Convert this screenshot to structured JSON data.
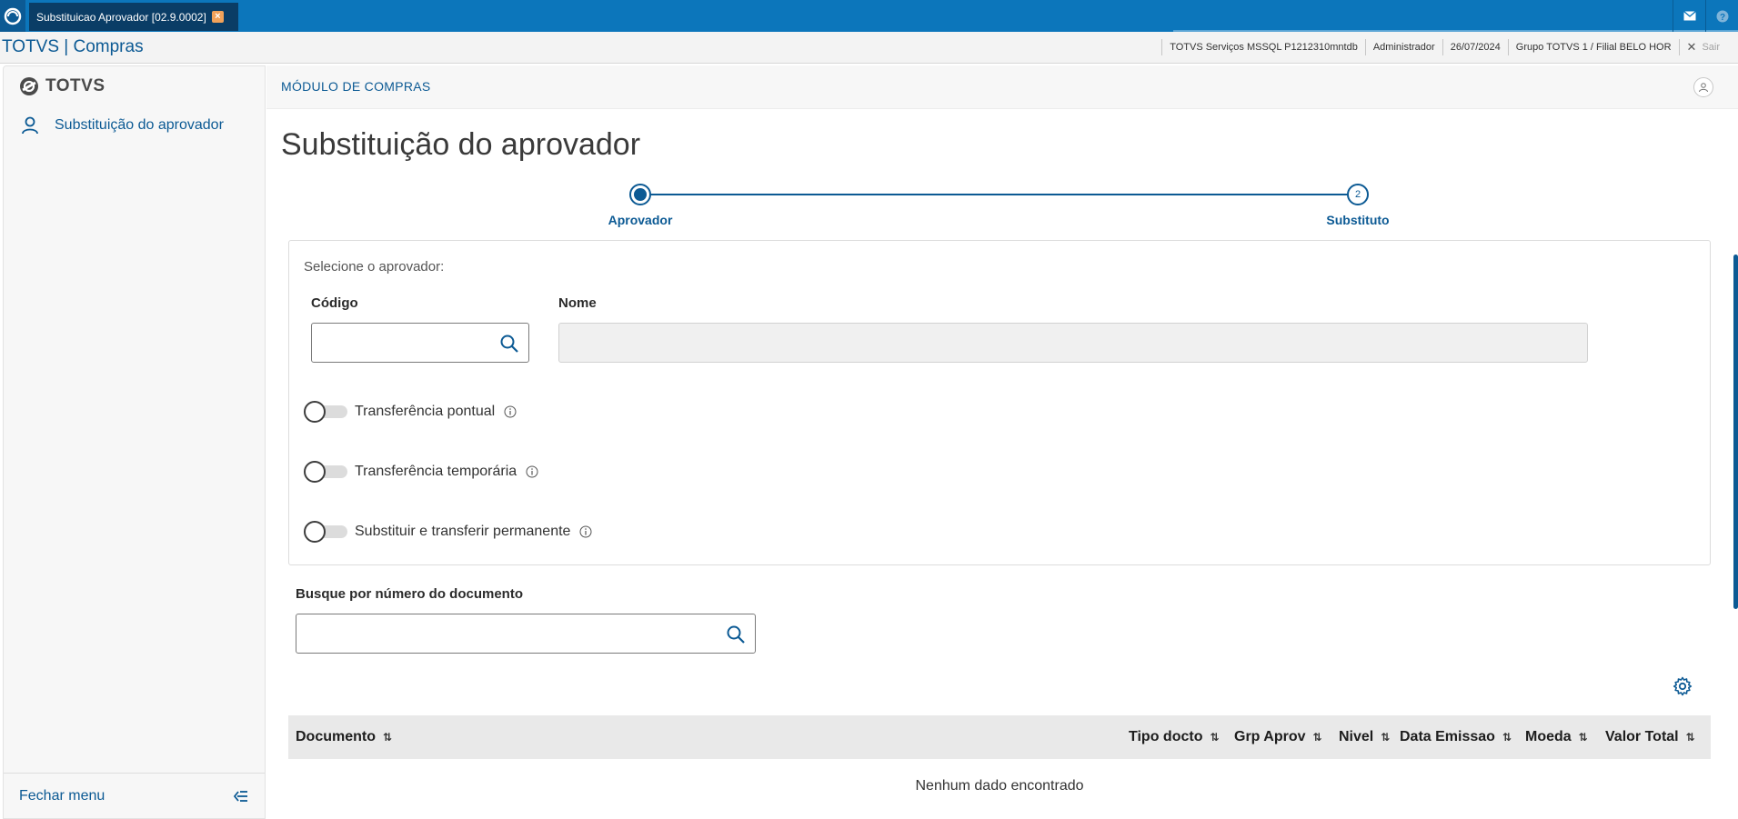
{
  "window": {
    "tab_title": "Substituicao Aprovador [02.9.0002]",
    "icons": [
      "mail-icon",
      "help-icon"
    ]
  },
  "infobar": {
    "brand": "TOTVS | Compras",
    "server": "TOTVS Serviços MSSQL P1212310mntdb",
    "user": "Administrador",
    "date": "26/07/2024",
    "branch": "Grupo TOTVS 1 / Filial BELO HOR",
    "exit_label": "Sair"
  },
  "sidebar": {
    "logo_text": "TOTVS",
    "items": [
      {
        "label": "Substituição do aprovador",
        "icon": "user-icon"
      }
    ],
    "close_menu_label": "Fechar menu"
  },
  "module": {
    "title": "MÓDULO DE COMPRAS"
  },
  "page": {
    "title": "Substituição do aprovador"
  },
  "stepper": {
    "steps": [
      {
        "label": "Aprovador",
        "number": "1",
        "state": "active"
      },
      {
        "label": "Substituto",
        "number": "2",
        "state": "pending"
      }
    ]
  },
  "approver": {
    "hint": "Selecione o aprovador:",
    "code_label": "Código",
    "code_value": "",
    "name_label": "Nome",
    "name_value": "",
    "toggles": [
      {
        "label": "Transferência pontual",
        "checked": false
      },
      {
        "label": "Transferência temporária",
        "checked": false
      },
      {
        "label": "Substituir e transferir permanente",
        "checked": false
      }
    ]
  },
  "doc_search": {
    "label": "Busque por número do documento",
    "value": ""
  },
  "table": {
    "columns": [
      "Documento",
      "Tipo docto",
      "Grp Aprov",
      "Nivel",
      "Data Emissao",
      "Moeda",
      "Valor Total"
    ],
    "rows": [],
    "empty_message": "Nenhum dado encontrado"
  },
  "colors": {
    "primary": "#0c5a94",
    "topbar": "#0c76bb"
  }
}
